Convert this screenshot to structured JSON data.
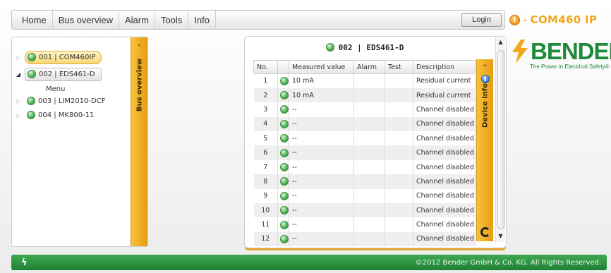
{
  "menu": {
    "items": [
      "Home",
      "Bus overview",
      "Alarm",
      "Tools",
      "Info"
    ],
    "login_label": "Login"
  },
  "status": {
    "alert_glyph": "!",
    "separator": "-",
    "device_name": "COM460 IP"
  },
  "logo": {
    "word": "BENDER",
    "tagline": "The Power in Electrical Safety®"
  },
  "tree": {
    "nodes": [
      {
        "label": "001 | COM460IP"
      },
      {
        "label": "002 | EDS461-D"
      },
      {
        "label": "003 | LIM2010-DCF"
      },
      {
        "label": "004 | MK800-11"
      }
    ],
    "submenu_label": "Menu",
    "tab_label": "Bus overview",
    "collapse_glyph": "‹"
  },
  "device": {
    "title": "002 | EDS461-D",
    "columns": [
      "No.",
      "",
      "Measured value",
      "Alarm",
      "Test",
      "Description"
    ],
    "rows": [
      {
        "no": "1",
        "value": "10 mA",
        "alarm": "",
        "test": "",
        "description": "Residual current"
      },
      {
        "no": "2",
        "value": "10 mA",
        "alarm": "",
        "test": "",
        "description": "Residual current"
      },
      {
        "no": "3",
        "value": "--",
        "alarm": "",
        "test": "",
        "description": "Channel disabled"
      },
      {
        "no": "4",
        "value": "--",
        "alarm": "",
        "test": "",
        "description": "Channel disabled"
      },
      {
        "no": "5",
        "value": "--",
        "alarm": "",
        "test": "",
        "description": "Channel disabled"
      },
      {
        "no": "6",
        "value": "--",
        "alarm": "",
        "test": "",
        "description": "Channel disabled"
      },
      {
        "no": "7",
        "value": "--",
        "alarm": "",
        "test": "",
        "description": "Channel disabled"
      },
      {
        "no": "8",
        "value": "--",
        "alarm": "",
        "test": "",
        "description": "Channel disabled"
      },
      {
        "no": "9",
        "value": "--",
        "alarm": "",
        "test": "",
        "description": "Channel disabled"
      },
      {
        "no": "10",
        "value": "--",
        "alarm": "",
        "test": "",
        "description": "Channel disabled"
      },
      {
        "no": "11",
        "value": "--",
        "alarm": "",
        "test": "",
        "description": "Channel disabled"
      },
      {
        "no": "12",
        "value": "--",
        "alarm": "",
        "test": "",
        "description": "Channel disabled"
      }
    ],
    "tab_label": "Device info",
    "expand_glyph": "⌄",
    "info_glyph": "i"
  },
  "scroll": {
    "up": "▲",
    "down": "▼"
  },
  "footer": {
    "logo_glyph": "ϟ",
    "copyright": "©2012 Bender GmbH & Co. KG. All Rights Reserved."
  },
  "colors": {
    "accent": "#f0a820",
    "brand_green": "#1e8a3a",
    "footer_green": "#2a9440",
    "ok_led": "#55b65a"
  }
}
